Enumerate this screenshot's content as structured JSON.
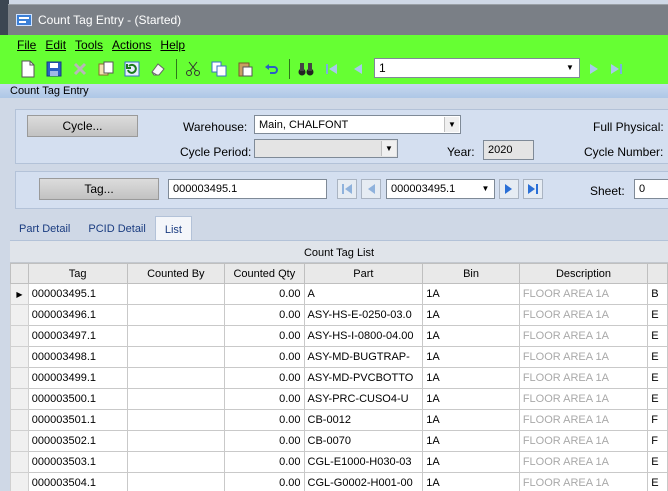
{
  "window": {
    "title": "Count Tag Entry - (Started)"
  },
  "menu": [
    "File",
    "Edit",
    "Tools",
    "Actions",
    "Help"
  ],
  "toolbar": {
    "icons": [
      "new-icon",
      "save-icon",
      "delete-icon",
      "copy-icon",
      "refresh-icon",
      "clear-icon",
      "cut-icon",
      "copy-to-icon",
      "paste-icon",
      "undo-icon",
      "binoculars-icon",
      "first-record-icon",
      "prev-record-icon",
      "next-record-icon",
      "last-record-icon"
    ],
    "record_value": "1"
  },
  "form": {
    "title": "Count Tag Entry",
    "cycle_button": "Cycle...",
    "warehouse_label": "Warehouse:",
    "warehouse_value": "Main, CHALFONT",
    "cycle_period_label": "Cycle Period:",
    "cycle_period_value": "",
    "year_label": "Year:",
    "year_value": "2020",
    "full_physical_label": "Full Physical:",
    "cycle_number_label": "Cycle Number:",
    "tag_button": "Tag...",
    "tag_value": "000003495.1",
    "tag_nav_value": "000003495.1",
    "sheet_label": "Sheet:",
    "sheet_value": "0"
  },
  "tabs": [
    {
      "label": "Part Detail",
      "active": false
    },
    {
      "label": "PCID Detail",
      "active": false
    },
    {
      "label": "List",
      "active": true
    }
  ],
  "grid": {
    "caption": "Count Tag List",
    "columns": [
      "Tag",
      "Counted By",
      "Counted Qty",
      "Part",
      "Bin",
      "Description",
      ""
    ],
    "rows": [
      {
        "tag": "000003495.1",
        "counted_by": "",
        "qty": "0.00",
        "part": "A",
        "bin": "1A",
        "desc": "FLOOR AREA 1A",
        "extra": "B"
      },
      {
        "tag": "000003496.1",
        "counted_by": "",
        "qty": "0.00",
        "part": "ASY-HS-E-0250-03.0",
        "bin": "1A",
        "desc": "FLOOR AREA 1A",
        "extra": "E"
      },
      {
        "tag": "000003497.1",
        "counted_by": "",
        "qty": "0.00",
        "part": "ASY-HS-I-0800-04.00",
        "bin": "1A",
        "desc": "FLOOR AREA 1A",
        "extra": "E"
      },
      {
        "tag": "000003498.1",
        "counted_by": "",
        "qty": "0.00",
        "part": "ASY-MD-BUGTRAP-",
        "bin": "1A",
        "desc": "FLOOR AREA 1A",
        "extra": "E"
      },
      {
        "tag": "000003499.1",
        "counted_by": "",
        "qty": "0.00",
        "part": "ASY-MD-PVCBOTTO",
        "bin": "1A",
        "desc": "FLOOR AREA 1A",
        "extra": "E"
      },
      {
        "tag": "000003500.1",
        "counted_by": "",
        "qty": "0.00",
        "part": "ASY-PRC-CUSO4-U",
        "bin": "1A",
        "desc": "FLOOR AREA 1A",
        "extra": "E"
      },
      {
        "tag": "000003501.1",
        "counted_by": "",
        "qty": "0.00",
        "part": "CB-0012",
        "bin": "1A",
        "desc": "FLOOR AREA 1A",
        "extra": "F"
      },
      {
        "tag": "000003502.1",
        "counted_by": "",
        "qty": "0.00",
        "part": "CB-0070",
        "bin": "1A",
        "desc": "FLOOR AREA 1A",
        "extra": "F"
      },
      {
        "tag": "000003503.1",
        "counted_by": "",
        "qty": "0.00",
        "part": "CGL-E1000-H030-03",
        "bin": "1A",
        "desc": "FLOOR AREA 1A",
        "extra": "E"
      },
      {
        "tag": "000003504.1",
        "counted_by": "",
        "qty": "0.00",
        "part": "CGL-G0002-H001-00",
        "bin": "1A",
        "desc": "FLOOR AREA 1A",
        "extra": "E"
      }
    ]
  }
}
